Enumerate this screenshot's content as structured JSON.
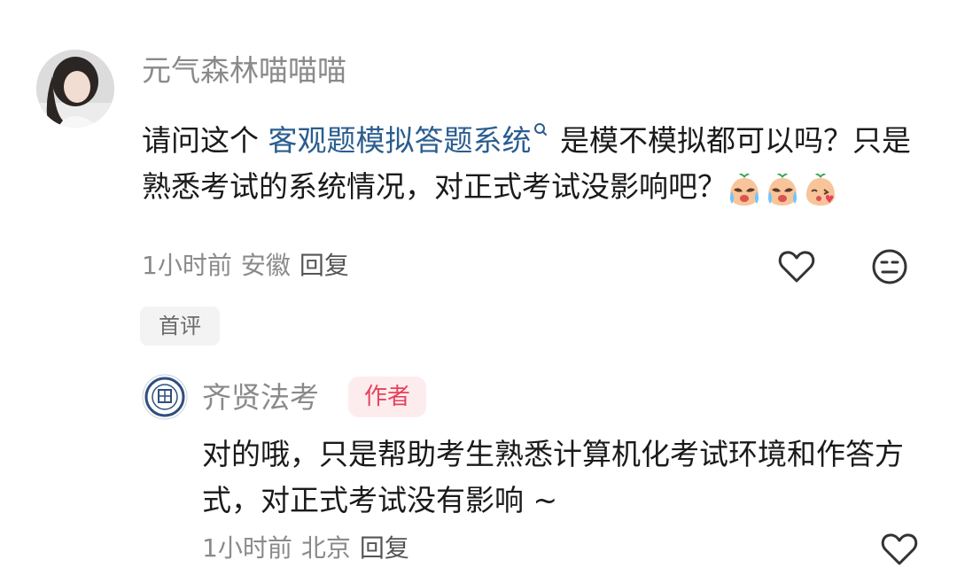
{
  "comment": {
    "username": "元气森林喵喵喵",
    "text_before": "请问这个 ",
    "keyword": "客观题模拟答题系统",
    "text_after": " 是模不模拟都可以吗？只是熟悉考试的系统情况，对正式考试没影响吧？",
    "emojis": [
      "crying-peach-emoji",
      "crying-peach-emoji",
      "kissing-peach-emoji"
    ],
    "time": "1小时前",
    "location": "安徽",
    "reply_label": "回复",
    "tag": "首评"
  },
  "reply": {
    "username": "齐贤法考",
    "badge": "作者",
    "text": "对的哦，只是帮助考生熟悉计算机化考试环境和作答方式，对正式考试没有影响 ~",
    "time": "1小时前",
    "location": "北京",
    "reply_label": "回复"
  },
  "colors": {
    "link": "#2a5d8f",
    "meta": "#8a8a8a",
    "badge_text": "#e8415a",
    "badge_bg": "#fdecee",
    "tag_bg": "#f3f3f3"
  },
  "icons": [
    "heart-icon",
    "neutral-face-icon",
    "search-icon"
  ]
}
